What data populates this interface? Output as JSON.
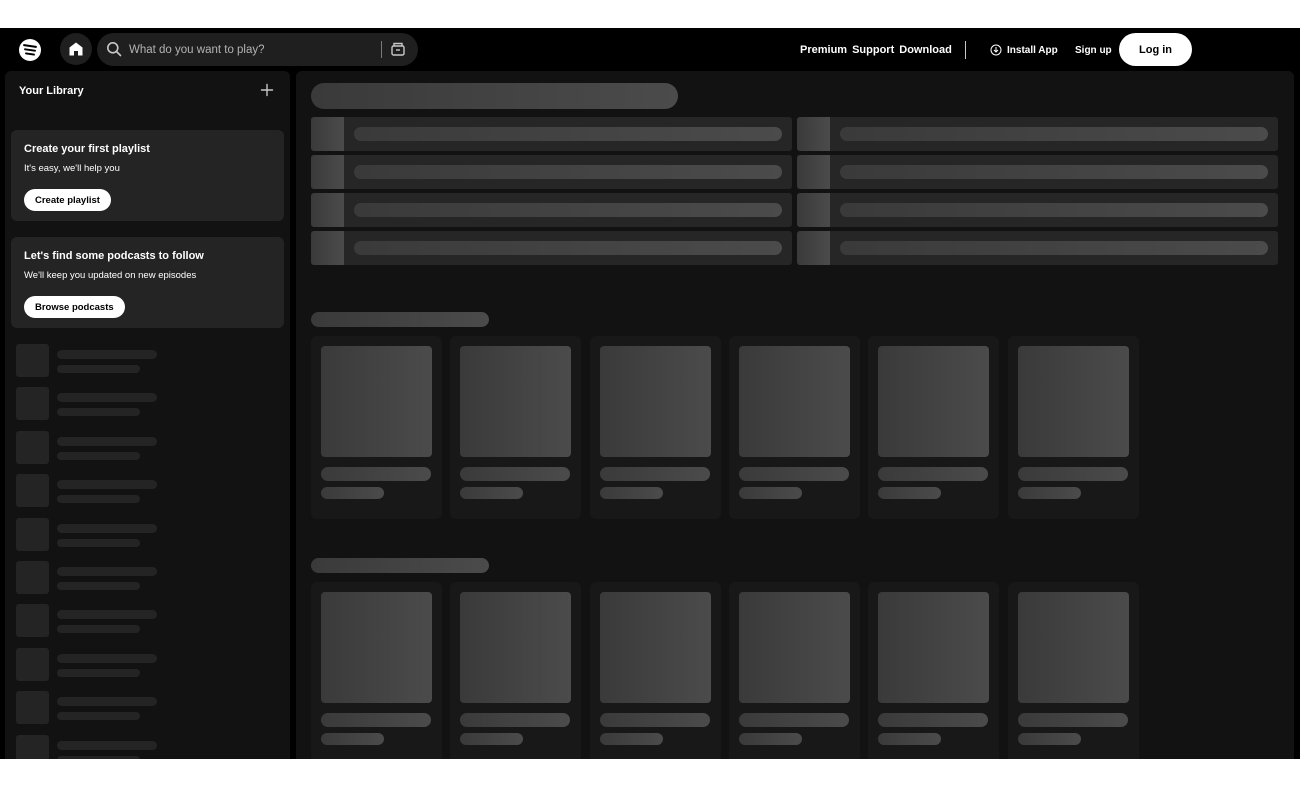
{
  "topbar": {
    "logo_icon": "spotify-logo-icon",
    "home_icon": "home-icon",
    "search": {
      "placeholder": "What do you want to play?",
      "icon": "search-icon",
      "browse_icon": "browse-icon"
    },
    "links": [
      "Premium",
      "Support",
      "Download"
    ],
    "install_app": "Install App",
    "install_icon": "download-circle-icon",
    "sign_up": "Sign up",
    "log_in": "Log in"
  },
  "sidebar": {
    "title": "Your Library",
    "add_icon": "plus-icon",
    "playlist_card": {
      "title": "Create your first playlist",
      "subtitle": "It's easy, we'll help you",
      "button": "Create playlist"
    },
    "podcast_card": {
      "title": "Let's find some podcasts to follow",
      "subtitle": "We'll keep you updated on new episodes",
      "button": "Browse podcasts"
    },
    "placeholder_item_count": 10
  },
  "colors": {
    "background": "#000000",
    "panel": "#121212",
    "card": "#242424",
    "skeleton": "#3a3a3a",
    "text": "#ffffff",
    "muted": "#b3b3b3"
  }
}
